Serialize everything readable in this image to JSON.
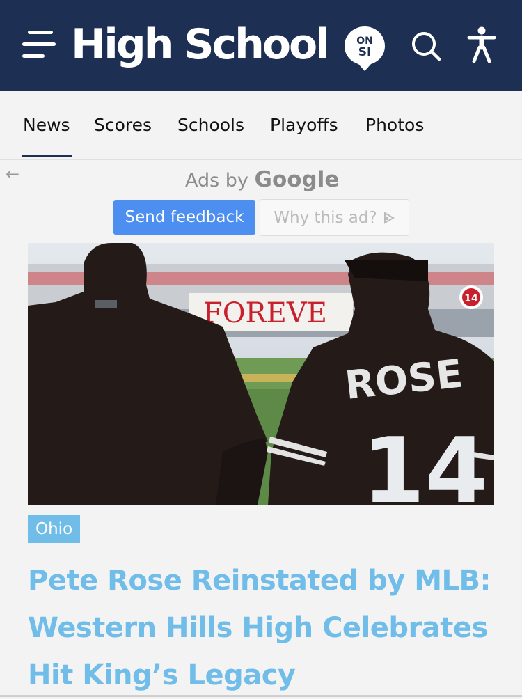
{
  "header": {
    "logo_text": "High School",
    "logo_badge": [
      "ON",
      "SI"
    ],
    "icons": {
      "menu": "hamburger-menu-icon",
      "search": "search-icon",
      "accessibility": "accessibility-icon"
    },
    "colors": {
      "background": "#1d2f52",
      "foreground": "#ffffff"
    }
  },
  "nav": {
    "tabs": [
      {
        "label": "News",
        "active": true
      },
      {
        "label": "Scores",
        "active": false
      },
      {
        "label": "Schools",
        "active": false
      },
      {
        "label": "Playoffs",
        "active": false
      },
      {
        "label": "Photos",
        "active": false
      }
    ]
  },
  "ad": {
    "ads_by_prefix": "Ads by",
    "ads_by_brand": "Google",
    "feedback_label": "Send feedback",
    "why_label": "Why this ad?",
    "colors": {
      "feedback_button": "#4c8ff1"
    }
  },
  "hero": {
    "banner_text": "FOREVE",
    "jersey_name": "ROSE",
    "jersey_number": "14",
    "pin_number": "14"
  },
  "article": {
    "tag": "Ohio",
    "headline": "Pete Rose Reinstated by MLB: Western Hills High Celebrates Hit King’s Legacy",
    "colors": {
      "accent": "#6fbde8"
    }
  }
}
